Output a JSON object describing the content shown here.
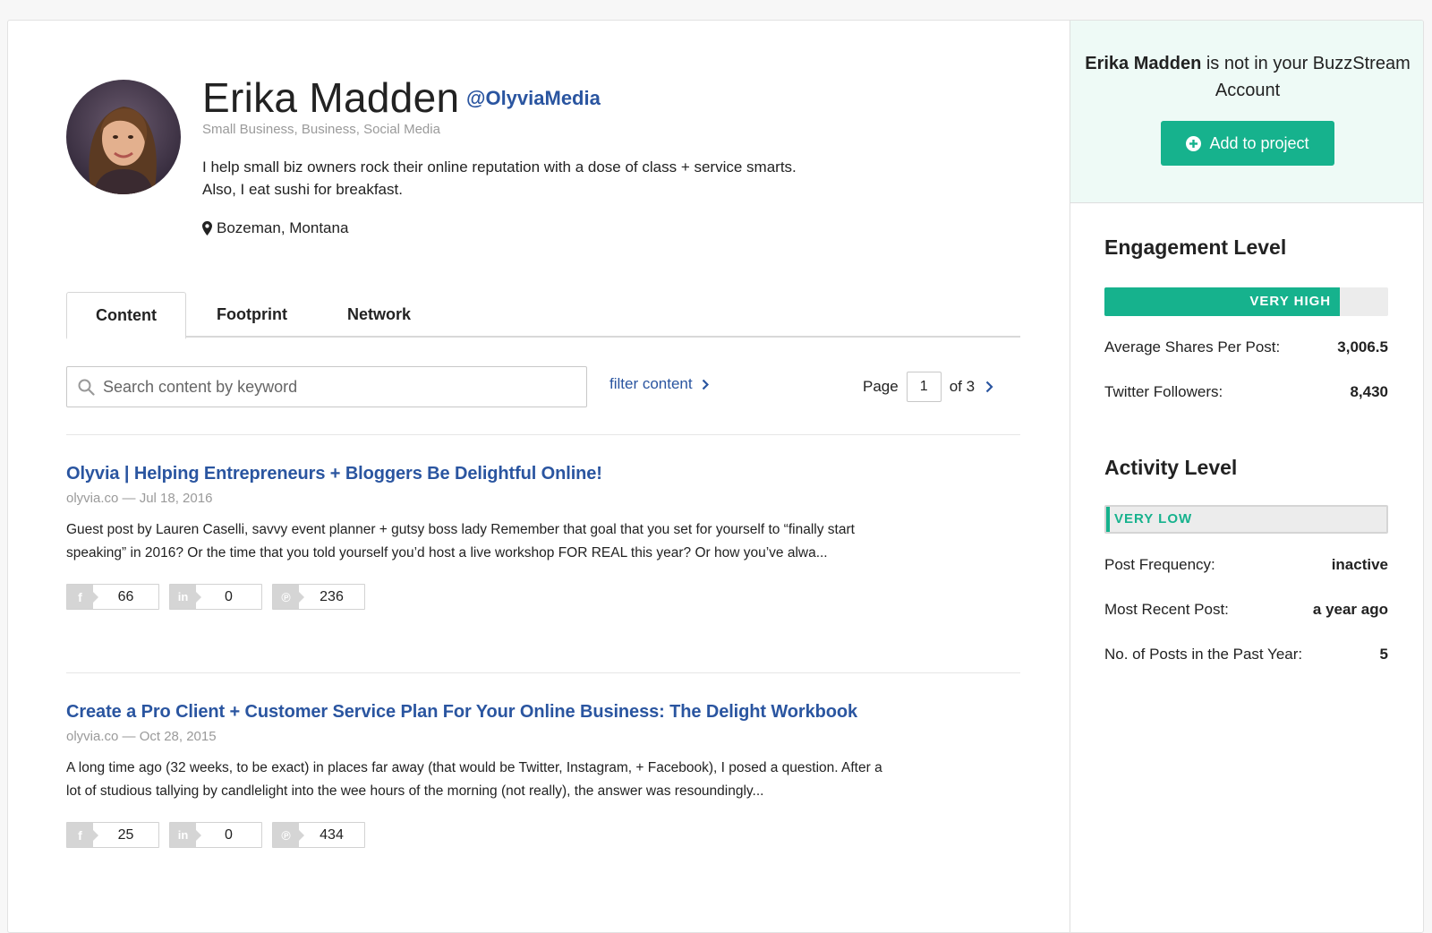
{
  "profile": {
    "name": "Erika Madden",
    "handle": "@OlyviaMedia",
    "categories": "Small Business, Business, Social Media",
    "bio": "I help small biz owners rock their online reputation with a dose of class + service smarts. Also, I eat sushi for breakfast.",
    "location": "Bozeman, Montana"
  },
  "tabs": [
    {
      "label": "Content",
      "active": true
    },
    {
      "label": "Footprint",
      "active": false
    },
    {
      "label": "Network",
      "active": false
    }
  ],
  "toolbar": {
    "search_placeholder": "Search content by keyword",
    "filter_label": "filter content",
    "page_label": "Page",
    "page_current": "1",
    "page_of": "of 3"
  },
  "posts": [
    {
      "title": "Olyvia | Helping Entrepreneurs + Bloggers Be Delightful Online!",
      "meta": "olyvia.co — Jul 18, 2016",
      "excerpt": "Guest post by Lauren Caselli, savvy event planner + gutsy boss lady Remember that goal that you set for yourself to “finally start speaking” in 2016? Or the time that you told yourself you’d host a live workshop FOR REAL this year? Or how you’ve alwa...",
      "facebook": "66",
      "linkedin": "0",
      "pinterest": "236"
    },
    {
      "title": "Create a Pro Client + Customer Service Plan For Your Online Business: The Delight Workbook",
      "meta": "olyvia.co — Oct 28, 2015",
      "excerpt": "A long time ago (32 weeks, to be exact) in places far away (that would be Twitter, Instagram, + Facebook), I posed a question. After a lot of studious tallying by candlelight into the wee hours of the morning (not really), the answer was resoundingly...",
      "facebook": "25",
      "linkedin": "0",
      "pinterest": "434"
    }
  ],
  "sidebar": {
    "account_name": "Erika Madden",
    "account_msg": " is not in your BuzzStream Account",
    "add_button": "Add to project",
    "engagement": {
      "title": "Engagement Level",
      "level": "VERY HIGH",
      "level_fraction": 0.83,
      "stats": [
        {
          "label": "Average Shares Per Post:",
          "value": "3,006.5"
        },
        {
          "label": "Twitter Followers:",
          "value": "8,430"
        }
      ]
    },
    "activity": {
      "title": "Activity Level",
      "level": "VERY LOW",
      "stats": [
        {
          "label": "Post Frequency:",
          "value": "inactive"
        },
        {
          "label": "Most Recent Post:",
          "value": "a year ago"
        },
        {
          "label": "No. of Posts in the Past Year:",
          "value": "5"
        }
      ]
    }
  },
  "colors": {
    "accent_green": "#16b28d",
    "link_blue": "#2a55a0"
  }
}
